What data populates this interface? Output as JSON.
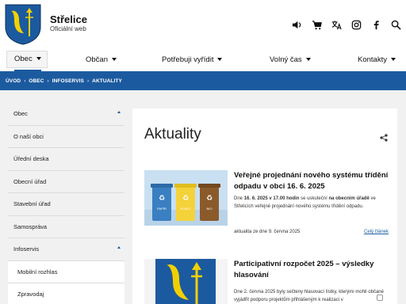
{
  "header": {
    "title": "Střelice",
    "subtitle": "Oficiální web",
    "icons": [
      "speaker-icon",
      "cart-icon",
      "translate-icon",
      "instagram-icon",
      "facebook-icon",
      "search-icon"
    ]
  },
  "nav": {
    "items": [
      {
        "label": "Obec"
      },
      {
        "label": "Občan"
      },
      {
        "label": "Potřebuji vyřídit"
      },
      {
        "label": "Volný čas"
      },
      {
        "label": "Kontakty"
      }
    ]
  },
  "breadcrumb": [
    "ÚVOD",
    "OBEC",
    "INFOSERVIS",
    "AKTUALITY"
  ],
  "sidebar": {
    "items": [
      {
        "label": "Obec"
      },
      {
        "label": "O naší obci"
      },
      {
        "label": "Úřední deska"
      },
      {
        "label": "Obecní úřad"
      },
      {
        "label": "Stavební úřad"
      },
      {
        "label": "Samospráva"
      },
      {
        "label": "Infoservis"
      },
      {
        "label": "Mobilní rozhlas"
      },
      {
        "label": "Zpravodaj"
      }
    ]
  },
  "main": {
    "title": "Aktuality",
    "articles": [
      {
        "title": "Veřejné projednání nového systému třídění odpadu v obci 16. 6. 2025",
        "text_1": "Dne ",
        "text_2": "16. 6. 2025 v 17.00 hodin",
        "text_3": " se uskuteční ",
        "text_4": "na obecním úřadě",
        "text_5": " ve Střelicích veřejné projednání nového systému třídění odpadu.",
        "meta": "aktualita ze dne 9. června 2025",
        "more": "Celý článek",
        "bin_labels": [
          "PAPÍR",
          "PLAST",
          "BIO"
        ]
      },
      {
        "title": "Participativní rozpočet 2025 – výsledky hlasování",
        "text": "Dne 2. června 2025 byly sečteny hlasovací lístky, kterými mohli občané vyjádřit podporu projektům přihlášeným k realizaci v"
      }
    ]
  },
  "colors": {
    "brand_blue": "#1c5a9f",
    "crest_yellow": "#f2d000",
    "bin_paper": "#3a7fc1",
    "bin_plastic": "#f4d23a",
    "bin_bio": "#8a5a2b"
  }
}
